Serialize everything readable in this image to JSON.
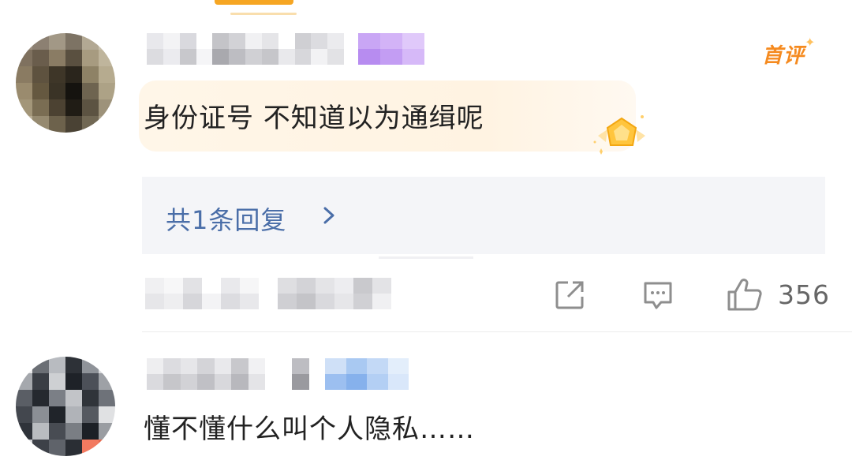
{
  "comments": [
    {
      "text": "身份证号 不知道以为通缉呢",
      "badge": "首评",
      "reply_summary": "共1条回复",
      "likes": "356"
    },
    {
      "text": "懂不懂什么叫个人隐私……"
    }
  ],
  "colors": {
    "accent": "#f58a1f",
    "link": "#4a6ea8",
    "reply_bg": "#f4f5f8",
    "highlight_bg": "#fff4e4",
    "icon_gray": "#8e8e8e"
  },
  "icons": [
    "share-icon",
    "comment-icon",
    "like-icon",
    "chevron-right-icon",
    "medal-icon",
    "sparkle-icon"
  ]
}
